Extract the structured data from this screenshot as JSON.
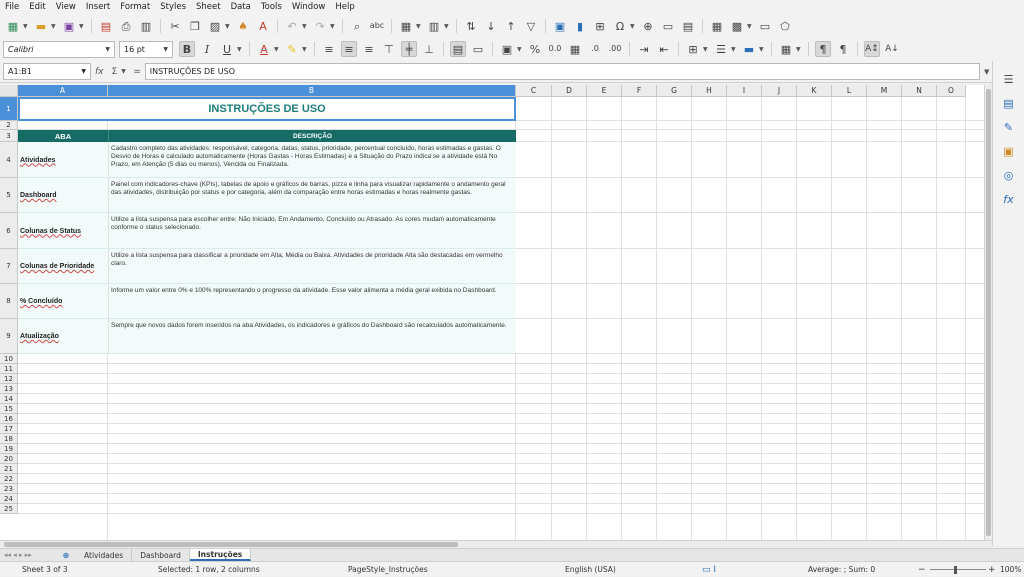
{
  "menu": [
    "File",
    "Edit",
    "View",
    "Insert",
    "Format",
    "Styles",
    "Sheet",
    "Data",
    "Tools",
    "Window",
    "Help"
  ],
  "font": {
    "name": "Calibri",
    "size": "16 pt"
  },
  "namebox": "A1:B1",
  "formula": "INSTRUÇÕES DE USO",
  "columns": [
    "A",
    "B",
    "C",
    "D",
    "E",
    "F",
    "G",
    "H",
    "I",
    "J",
    "K",
    "L",
    "M",
    "N",
    "O"
  ],
  "rows_numbers": [
    "1",
    "2",
    "3",
    "4",
    "5",
    "6",
    "7",
    "8",
    "9",
    "10",
    "11",
    "12",
    "13",
    "14",
    "15",
    "16",
    "17",
    "18",
    "19",
    "20",
    "21",
    "22",
    "23",
    "24",
    "25"
  ],
  "sheet": {
    "title": "INSTRUÇÕES DE USO",
    "header": {
      "aba": "ABA",
      "descricao": "DESCRIÇÃO"
    },
    "rows": [
      {
        "aba": "Atividades",
        "descricao": "Cadastro completo das atividades: responsável, categoria, datas, status, prioridade, percentual concluído, horas estimadas e gastas. O Desvio de Horas é calculado automaticamente (Horas Gastas - Horas Estimadas) e a Situação do Prazo indica se a atividade está No Prazo, em Atenção (5 dias ou menos), Vencida ou Finalizada."
      },
      {
        "aba": "Dashboard",
        "descricao": "Painel com indicadores-chave (KPIs), tabelas de apoio e gráficos de barras, pizza e linha para visualizar rapidamente o andamento geral das atividades, distribuição por status e por categoria, além da comparação entre horas estimadas e horas realmente gastas."
      },
      {
        "aba": "Colunas de Status",
        "descricao": "Utilize a lista suspensa para escolher entre: Não Iniciado, Em Andamento, Concluído ou Atrasado. As cores mudam automaticamente conforme o status selecionado."
      },
      {
        "aba": "Colunas de Prioridade",
        "descricao": "Utilize a lista suspensa para classificar a prioridade em Alta, Média ou Baixa. Atividades de prioridade Alta são destacadas em vermelho claro."
      },
      {
        "aba": "% Concluído",
        "descricao": "Informe um valor entre 0% e 100% representando o progresso da atividade. Esse valor alimenta a média geral exibida no Dashboard."
      },
      {
        "aba": "Atualização",
        "descricao": "Sempre que novos dados forem inseridos na aba Atividades, os indicadores e gráficos do Dashboard são recalculados automaticamente."
      }
    ]
  },
  "tabs": [
    "Atividades",
    "Dashboard",
    "Instruções"
  ],
  "active_tab": "Instruções",
  "status": {
    "sheet": "Sheet 3 of 3",
    "selection": "Selected: 1 row, 2 columns",
    "pagestyle": "PageStyle_Instruções",
    "language": "English (USA)",
    "summary": "Average: ; Sum: 0",
    "zoom": "100%"
  },
  "colors": {
    "accent": "#166b65",
    "title": "#1b7e7a",
    "selection": "#4a90d9"
  }
}
